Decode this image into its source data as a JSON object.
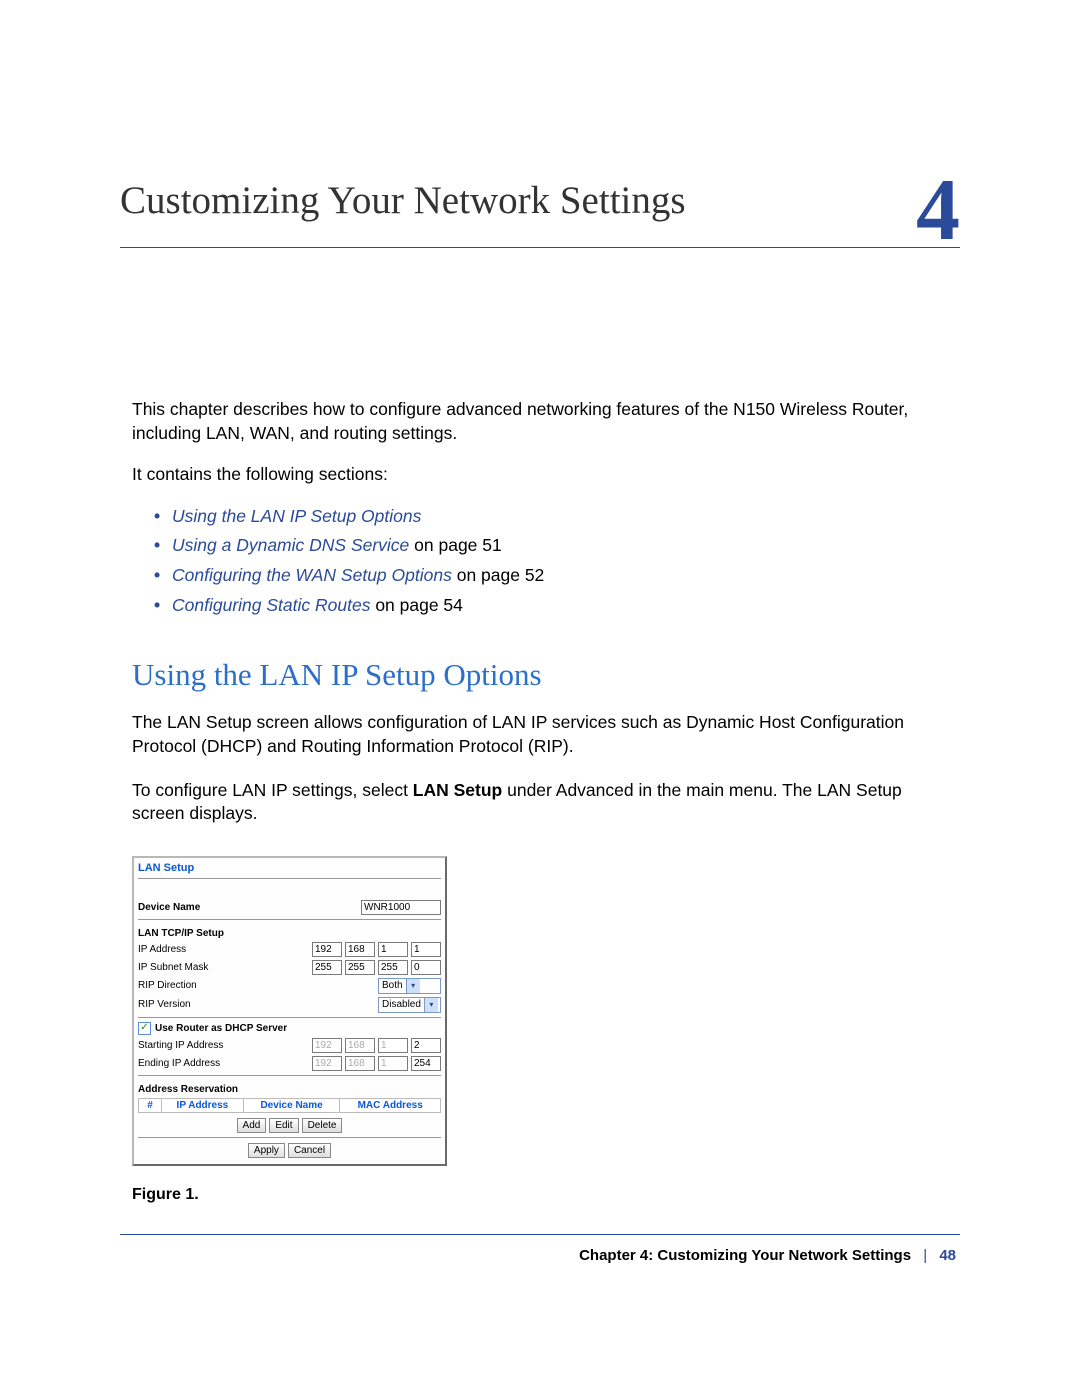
{
  "chapter": {
    "title": "Customizing Your Network Settings",
    "number": "4"
  },
  "intro": {
    "p1": "This chapter describes how to configure advanced networking features of the N150 Wireless Router, including LAN, WAN, and routing settings.",
    "p2": "It contains the following sections:"
  },
  "toc": [
    {
      "link": "Using the LAN IP Setup Options",
      "suffix": ""
    },
    {
      "link": "Using a Dynamic DNS Service",
      "suffix": " on page 51"
    },
    {
      "link": "Configuring the WAN Setup Options",
      "suffix": " on page 52"
    },
    {
      "link": "Configuring Static Routes",
      "suffix": " on page 54"
    }
  ],
  "section": {
    "heading": "Using the LAN IP Setup Options",
    "p1": "The LAN Setup screen allows configuration of LAN IP services such as Dynamic Host Configuration Protocol (DHCP) and Routing Information Protocol (RIP).",
    "p2a": "To configure LAN IP settings, select ",
    "p2bold": "LAN Setup",
    "p2b": " under Advanced in the main menu. The LAN Setup screen displays."
  },
  "panel": {
    "title": "LAN Setup",
    "device_name_label": "Device Name",
    "device_name_value": "WNR1000",
    "tcpip_title": "LAN TCP/IP Setup",
    "ip_label": "IP Address",
    "ip": [
      "192",
      "168",
      "1",
      "1"
    ],
    "subnet_label": "IP Subnet Mask",
    "subnet": [
      "255",
      "255",
      "255",
      "0"
    ],
    "ripdir_label": "RIP Direction",
    "ripdir_value": "Both",
    "ripver_label": "RIP Version",
    "ripver_value": "Disabled",
    "dhcp_check_label": "Use Router as DHCP Server",
    "start_label": "Starting IP Address",
    "start_ip": [
      "192",
      "168",
      "1",
      "2"
    ],
    "end_label": "Ending IP Address",
    "end_ip": [
      "192",
      "168",
      "1",
      "254"
    ],
    "reservation_title": "Address Reservation",
    "table_headers": [
      "#",
      "IP Address",
      "Device Name",
      "MAC Address"
    ],
    "btn_add": "Add",
    "btn_edit": "Edit",
    "btn_delete": "Delete",
    "btn_apply": "Apply",
    "btn_cancel": "Cancel"
  },
  "figure_caption": "Figure 1.",
  "footer": {
    "text": "Chapter 4:  Customizing Your Network Settings",
    "sep": "|",
    "page": "48"
  }
}
